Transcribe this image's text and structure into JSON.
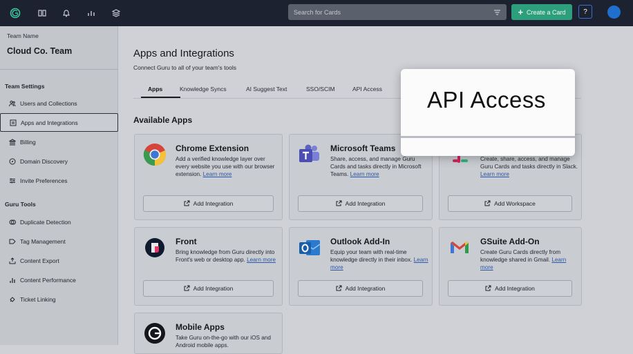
{
  "topbar": {
    "search_placeholder": "Search for Cards",
    "create_label": "Create a Card",
    "help_label": "?"
  },
  "sidebar": {
    "team_label": "Team Name",
    "team_name": "Cloud Co. Team",
    "settings_heading": "Team Settings",
    "settings_items": [
      {
        "label": "Users and Collections",
        "icon": "users-icon"
      },
      {
        "label": "Apps and Integrations",
        "icon": "apps-icon",
        "active": true
      },
      {
        "label": "Billing",
        "icon": "bank-icon"
      },
      {
        "label": "Domain Discovery",
        "icon": "compass-icon"
      },
      {
        "label": "Invite Preferences",
        "icon": "sliders-icon"
      }
    ],
    "tools_heading": "Guru Tools",
    "tools_items": [
      {
        "label": "Duplicate Detection",
        "icon": "duplicate-icon"
      },
      {
        "label": "Tag Management",
        "icon": "tag-icon"
      },
      {
        "label": "Content Export",
        "icon": "export-icon"
      },
      {
        "label": "Content Performance",
        "icon": "bar-chart-icon"
      },
      {
        "label": "Ticket Linking",
        "icon": "ticket-icon"
      }
    ]
  },
  "main": {
    "title": "Apps and Integrations",
    "subtitle": "Connect Guru to all of your team's tools",
    "tabs": [
      "Apps",
      "Knowledge Syncs",
      "AI Suggest Text",
      "SSO/SCIM",
      "API Access"
    ],
    "active_tab": "Apps",
    "section_title": "Available Apps"
  },
  "cards": [
    {
      "title": "Chrome Extension",
      "desc": "Add a verified knowledge layer over every website you use with our browser extension.",
      "more": "Learn more",
      "button": "Add Integration"
    },
    {
      "title": "Microsoft Teams",
      "desc": "Share, access, and manage Guru Cards and tasks directly in Microsoft Teams.",
      "more": "Learn more",
      "button": "Add Integration"
    },
    {
      "title": "",
      "desc": "Create, share, access, and manage Guru Cards and tasks directly in Slack.",
      "more": "Learn more",
      "button": "Add Workspace"
    },
    {
      "title": "Front",
      "desc": "Bring knowledge from Guru directly into Front's web or desktop app.",
      "more": "Learn more",
      "button": "Add Integration"
    },
    {
      "title": "Outlook Add-In",
      "desc": "Equip your team with real-time knowledge directly in their inbox.",
      "more": "Learn more",
      "button": "Add Integration"
    },
    {
      "title": "GSuite Add-On",
      "desc": "Create Guru Cards directly from knowledge shared in Gmail.",
      "more": "Learn more",
      "button": "Add Integration"
    },
    {
      "title": "Mobile Apps",
      "desc": "Take Guru on-the-go with our iOS and Android mobile apps.",
      "more": "",
      "button": ""
    }
  ],
  "zoom_callout": {
    "text": "API Access"
  },
  "colors": {
    "topbar": "#1c2230",
    "create_button": "#2e9f7c",
    "link": "#2a57a8",
    "avatar": "#1f6fcf"
  }
}
